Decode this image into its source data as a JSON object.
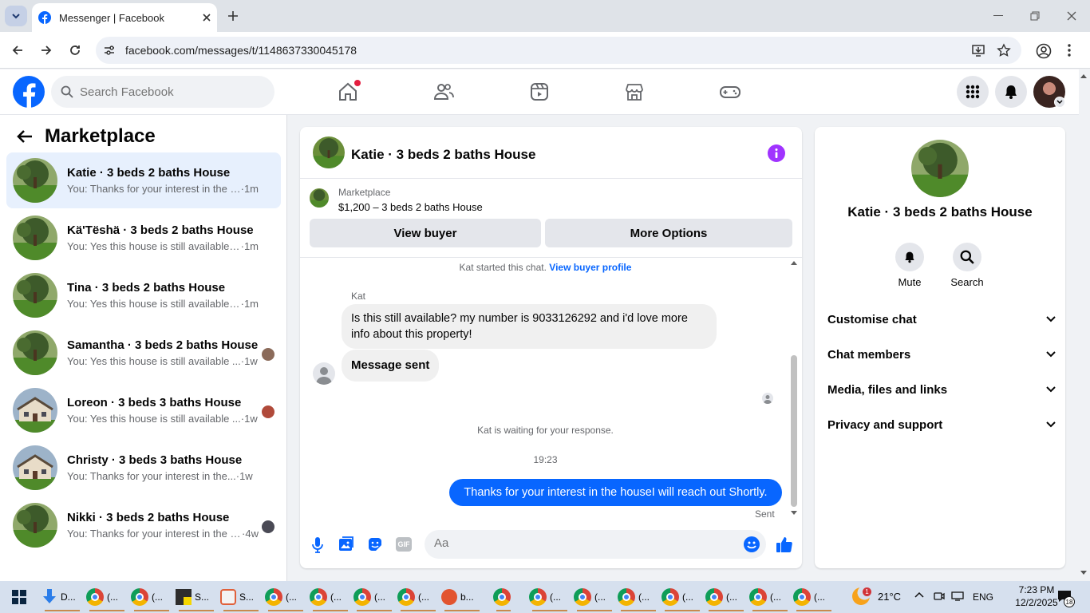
{
  "browser": {
    "tab_title": "Messenger | Facebook",
    "url": "facebook.com/messages/t/1148637330045178"
  },
  "header": {
    "search_placeholder": "Search Facebook"
  },
  "sidebar": {
    "title": "Marketplace",
    "conversations": [
      {
        "name": "Katie · 3 beds 2 baths House",
        "snippet": "You: Thanks for your interest in the h...",
        "time": "·1m",
        "active": true
      },
      {
        "name": "Kä'Tëshä · 3 beds 2 baths House",
        "snippet": "You: Yes this house is still available fo...",
        "time": "·1m"
      },
      {
        "name": "Tina · 3 beds 2 baths House",
        "snippet": "You: Yes this house is still available fo...",
        "time": "·1m"
      },
      {
        "name": "Samantha · 3 beds 2 baths House",
        "snippet": "You: Yes this house is still available ...",
        "time": "·1w"
      },
      {
        "name": "Loreon · 3 beds 3 baths House",
        "snippet": "You: Yes this house is still available ...",
        "time": "·1w"
      },
      {
        "name": "Christy · 3 beds 3 baths House",
        "snippet": "You: Thanks for your interest in the...",
        "time": "·1w"
      },
      {
        "name": "Nikki · 3 beds 2 baths House",
        "snippet": "You: Thanks for your interest in the h...",
        "time": "·4w"
      }
    ]
  },
  "chat": {
    "title": "Katie · 3 beds 2 baths House",
    "card_label": "Marketplace",
    "card_listing": "$1,200 – 3 beds 2 baths House",
    "view_buyer": "View buyer",
    "more_options": "More Options",
    "started_text": "Kat started this chat.",
    "view_profile_link": "View buyer profile",
    "sender_name": "Kat",
    "incoming_message": "Is this still available? my number is 9033126292 and i'd love more info about this property!",
    "message_sent": "Message sent",
    "waiting_text": "Kat is waiting for your response.",
    "time": "19:23",
    "outgoing_message": "Thanks for your interest in the houseI will reach out Shortly.",
    "sent_status": "Sent",
    "composer_placeholder": "Aa"
  },
  "info_panel": {
    "title": "Katie · 3 beds 2 baths House",
    "mute_label": "Mute",
    "search_label": "Search",
    "rows": [
      "Customise chat",
      "Chat members",
      "Media, files and links",
      "Privacy and support"
    ]
  },
  "taskbar": {
    "items": [
      "D...",
      "(...",
      "(...",
      "S...",
      "S...",
      "(...",
      "(...",
      "(...",
      "(...",
      "b...",
      "",
      "(...",
      "(...",
      "(...",
      "(...",
      "(...",
      "(...",
      "(..."
    ],
    "weather": "21°C",
    "weather_badge": "1",
    "language": "ENG",
    "clock_time": "7:23 PM",
    "clock_date": "12/2/2025",
    "notifications": "18"
  },
  "colors": {
    "fb_blue": "#0866ff",
    "messenger_purple": "#a033ff",
    "active_row": "#e7f0fd"
  }
}
